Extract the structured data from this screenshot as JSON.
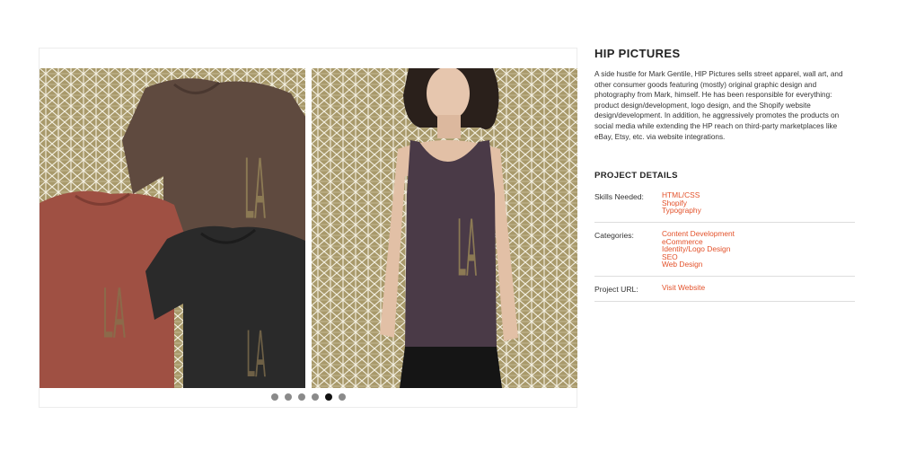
{
  "project": {
    "title": "HIP PICTURES",
    "description": "A side hustle for Mark Gentile, HIP Pictures sells street apparel, wall art, and other consumer goods featuring (mostly) original graphic design and photography from Mark, himself. He has been responsible for everything: product design/development, logo design, and the Shopify website design/development. In addition, he aggressively promotes the products on social media while extending the HP reach on third-party marketplaces like eBay, Etsy, etc. via website integrations."
  },
  "details": {
    "heading": "PROJECT DETAILS",
    "skills_label": "Skills Needed:",
    "skills": [
      "HTML/CSS",
      "Shopify",
      "Typography"
    ],
    "categories_label": "Categories:",
    "categories": [
      "Content Development",
      "eCommerce",
      "Identity/Logo Design",
      "SEO",
      "Web Design"
    ],
    "url_label": "Project URL:",
    "url_link": "Visit Website"
  },
  "slider": {
    "slide_count": 6,
    "active_index": 4,
    "logo_mark": "LA"
  },
  "colors": {
    "accent": "#e3522b",
    "pattern_bg": "#a8996a",
    "shirt_brown": "#5f4a3f",
    "shirt_red": "#9f5043",
    "shirt_black": "#2a2a2a",
    "tank_purple": "#4a3a47"
  }
}
